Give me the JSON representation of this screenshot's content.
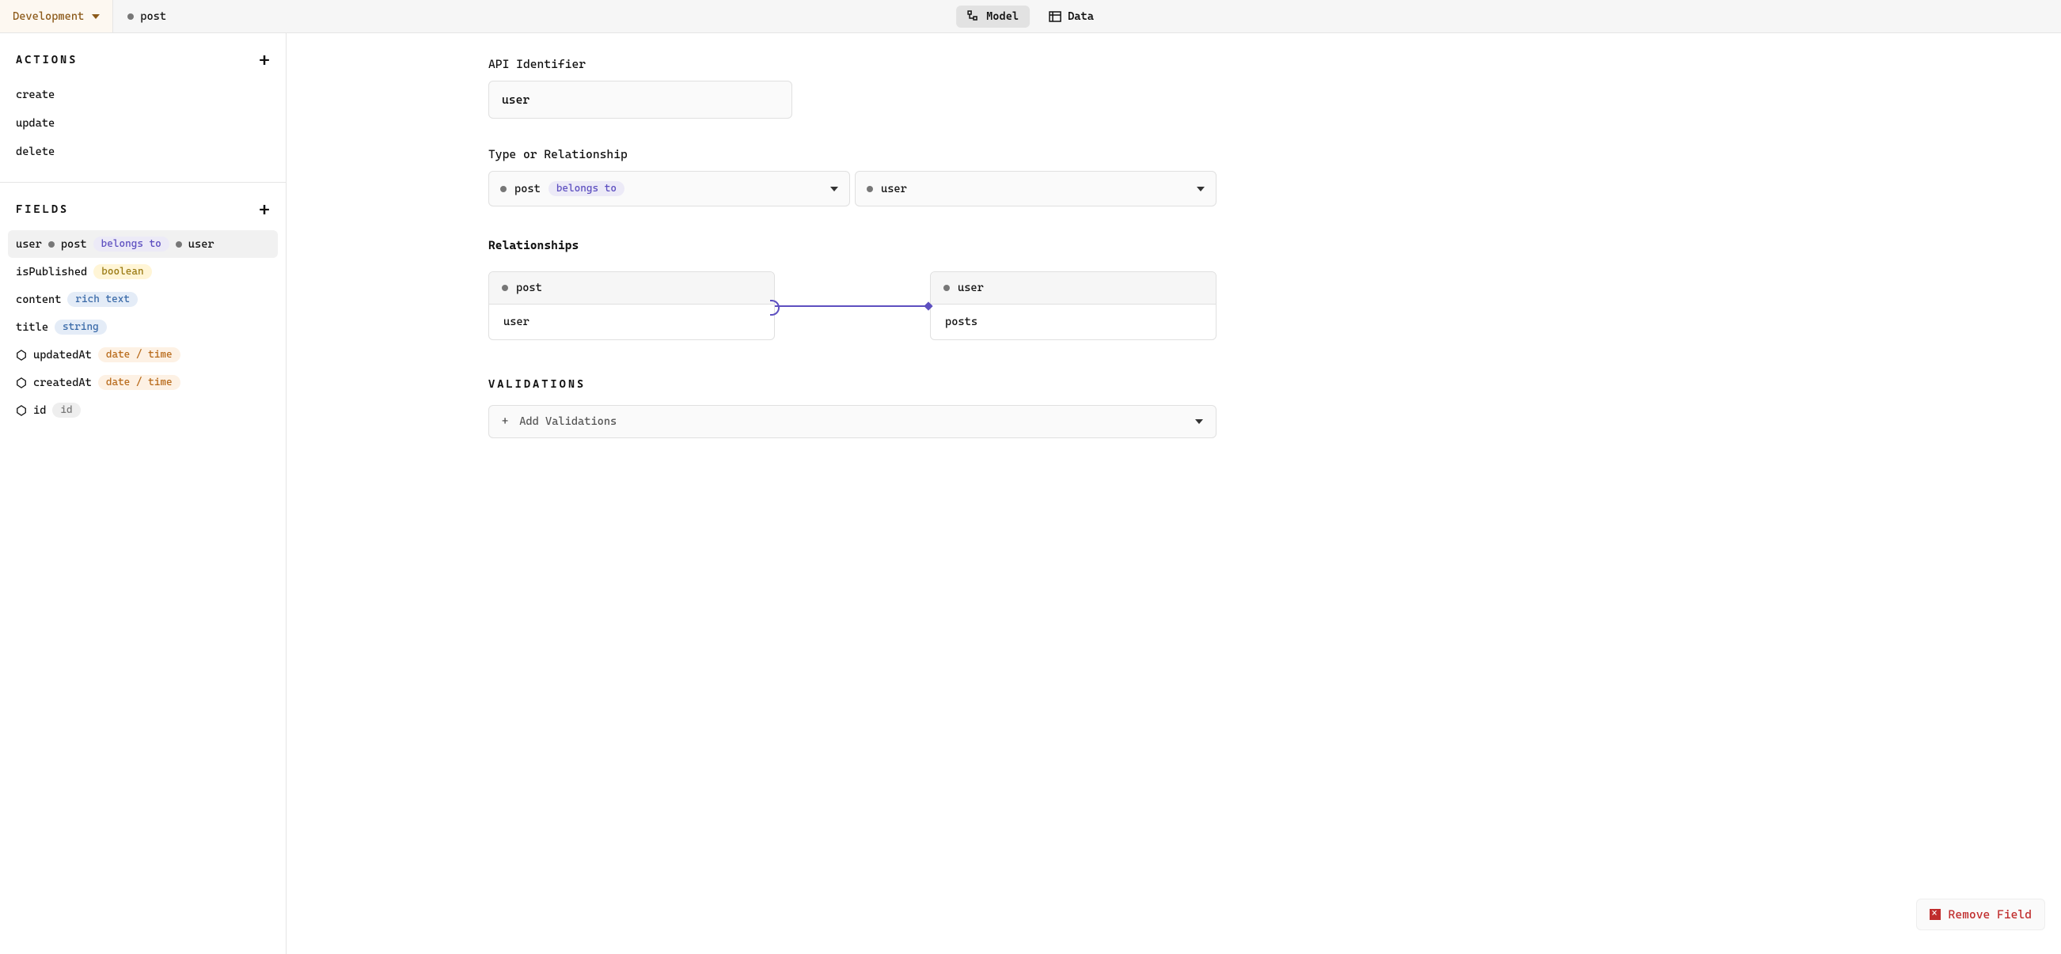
{
  "topbar": {
    "environment": "Development",
    "model_name": "post",
    "view_model": "Model",
    "view_data": "Data"
  },
  "sidebar": {
    "actions_title": "ACTIONS",
    "actions": [
      "create",
      "update",
      "delete"
    ],
    "fields_title": "FIELDS",
    "fields": [
      {
        "name": "user",
        "rel_from": "post",
        "rel_type": "belongs to",
        "rel_to": "user",
        "selected": true,
        "system": false
      },
      {
        "name": "isPublished",
        "type": "boolean",
        "badge": "yellow",
        "system": false
      },
      {
        "name": "content",
        "type": "rich text",
        "badge": "blue",
        "system": false
      },
      {
        "name": "title",
        "type": "string",
        "badge": "blue",
        "system": false
      },
      {
        "name": "updatedAt",
        "type": "date / time",
        "badge": "orange",
        "system": true
      },
      {
        "name": "createdAt",
        "type": "date / time",
        "badge": "orange",
        "system": true
      },
      {
        "name": "id",
        "type": "id",
        "badge": "gray",
        "system": true
      }
    ]
  },
  "main": {
    "api_identifier_label": "API Identifier",
    "api_identifier_value": "user",
    "type_label": "Type or Relationship",
    "rel_from": "post",
    "rel_type": "belongs to",
    "rel_target": "user",
    "relationships_heading": "Relationships",
    "rel_card_left_header": "post",
    "rel_card_left_body": "user",
    "rel_card_right_header": "user",
    "rel_card_right_body": "posts",
    "validations_title": "VALIDATIONS",
    "add_validations": "Add Validations",
    "remove_field": "Remove Field"
  }
}
